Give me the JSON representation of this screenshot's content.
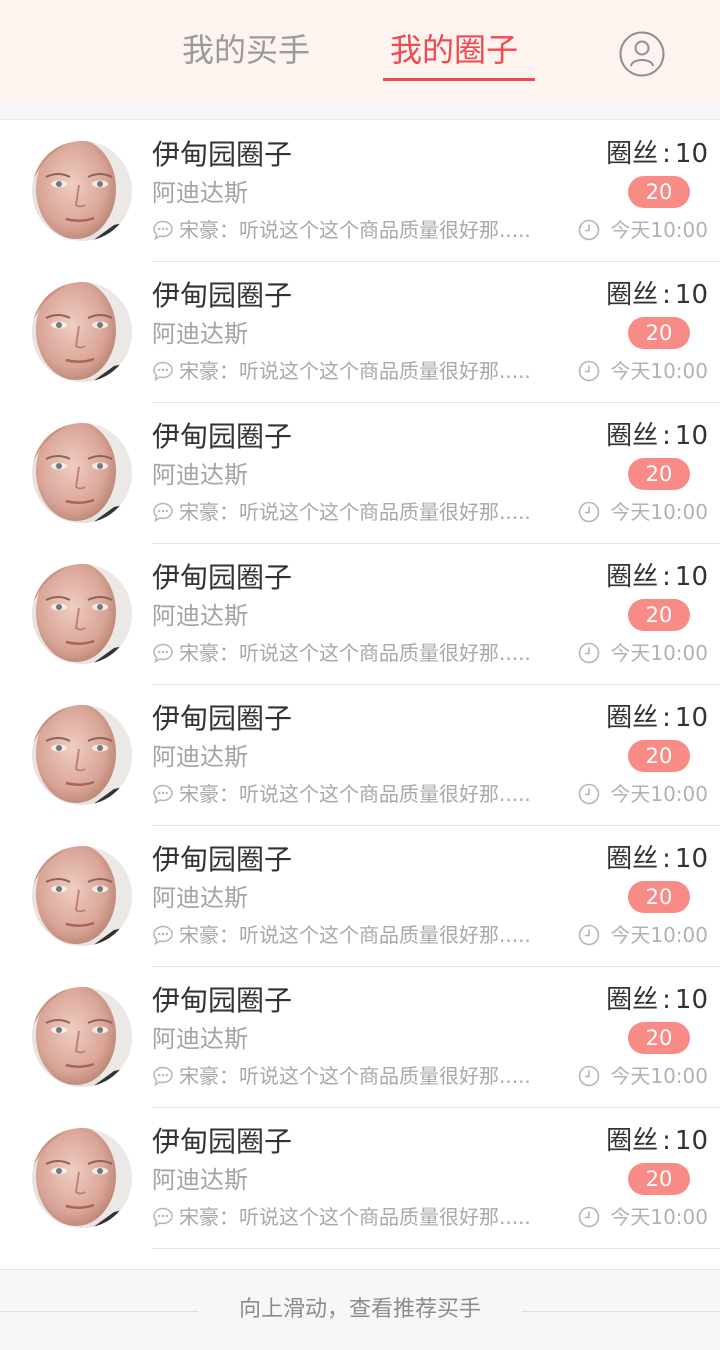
{
  "header": {
    "tabs": [
      {
        "label": "我的买手",
        "active": false
      },
      {
        "label": "我的圈子",
        "active": true
      }
    ],
    "accent_color": "#f2484f",
    "user_icon": "user-icon"
  },
  "circles": [
    {
      "name": "伊甸园圈子",
      "brand": "阿迪达斯",
      "fans_label": "圈丝",
      "fans_count": "10",
      "badge": "20",
      "last_message": "宋豪：听说这个这个商品质量很好那.....",
      "time": "今天10:00"
    },
    {
      "name": "伊甸园圈子",
      "brand": "阿迪达斯",
      "fans_label": "圈丝",
      "fans_count": "10",
      "badge": "20",
      "last_message": "宋豪：听说这个这个商品质量很好那.....",
      "time": "今天10:00"
    },
    {
      "name": "伊甸园圈子",
      "brand": "阿迪达斯",
      "fans_label": "圈丝",
      "fans_count": "10",
      "badge": "20",
      "last_message": "宋豪：听说这个这个商品质量很好那.....",
      "time": "今天10:00"
    },
    {
      "name": "伊甸园圈子",
      "brand": "阿迪达斯",
      "fans_label": "圈丝",
      "fans_count": "10",
      "badge": "20",
      "last_message": "宋豪：听说这个这个商品质量很好那.....",
      "time": "今天10:00"
    },
    {
      "name": "伊甸园圈子",
      "brand": "阿迪达斯",
      "fans_label": "圈丝",
      "fans_count": "10",
      "badge": "20",
      "last_message": "宋豪：听说这个这个商品质量很好那.....",
      "time": "今天10:00"
    },
    {
      "name": "伊甸园圈子",
      "brand": "阿迪达斯",
      "fans_label": "圈丝",
      "fans_count": "10",
      "badge": "20",
      "last_message": "宋豪：听说这个这个商品质量很好那.....",
      "time": "今天10:00"
    },
    {
      "name": "伊甸园圈子",
      "brand": "阿迪达斯",
      "fans_label": "圈丝",
      "fans_count": "10",
      "badge": "20",
      "last_message": "宋豪：听说这个这个商品质量很好那.....",
      "time": "今天10:00"
    },
    {
      "name": "伊甸园圈子",
      "brand": "阿迪达斯",
      "fans_label": "圈丝",
      "fans_count": "10",
      "badge": "20",
      "last_message": "宋豪：听说这个这个商品质量很好那.....",
      "time": "今天10:00"
    }
  ],
  "footer": {
    "hint": "向上滑动，查看推荐买手"
  },
  "colors": {
    "badge": "#f98b87",
    "header_bg": "#fdf3ef",
    "inactive_tab": "#9a9a9a"
  },
  "icons": {
    "message": "chat-bubble-icon",
    "time": "clock-icon",
    "avatar": "avatar-portrait"
  }
}
